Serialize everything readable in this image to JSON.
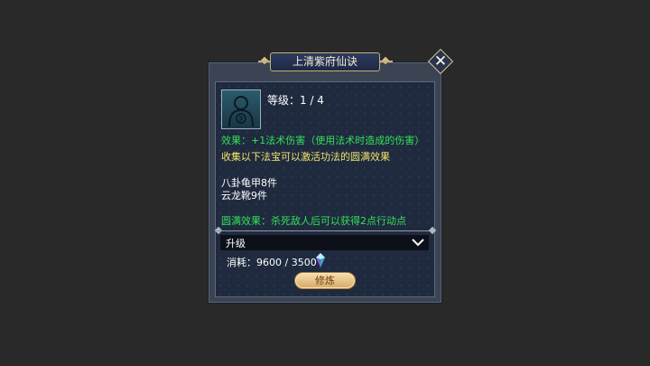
{
  "dialog": {
    "title": "上清紫府仙诀",
    "close_icon": "close-icon"
  },
  "skill": {
    "portrait_icon": "silhouette-portrait-icon",
    "level_text": "等级：1 / 4",
    "effect_text": "效果：+1法术伤害（使用法术时造成的伤害）",
    "collect_text": "收集以下法宝可以激活功法的圆满效果",
    "items": [
      "八卦龟甲8件",
      "云龙靴9件"
    ],
    "complete_effect_text": "圆满效果：杀死敌人后可以获得2点行动点"
  },
  "upgrade": {
    "selected": "升级",
    "cost_text": "消耗：9600 / 3500",
    "cost_icon": "gem-icon",
    "button_label": "修炼"
  },
  "colors": {
    "effect": "#33e05a",
    "collect": "#f3e36a",
    "button": "#e9c88a"
  }
}
